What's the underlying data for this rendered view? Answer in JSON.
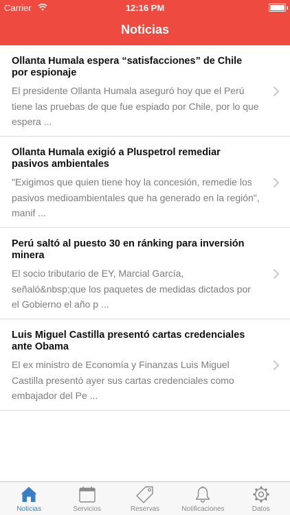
{
  "status_bar": {
    "carrier": "Carrier",
    "time": "12:16 PM"
  },
  "header": {
    "title": "Noticias"
  },
  "news": [
    {
      "title": "Ollanta Humala espera “satisfacciones” de Chile por espionaje",
      "summary": "El presidente Ollanta Humala aseguró hoy que el Perú tiene las pruebas de que fue espiado por Chile, por lo que espera ..."
    },
    {
      "title": "Ollanta Humala exigió a Pluspetrol remediar pasivos ambientales",
      "summary": "\"Exigimos que quien tiene hoy la concesión, remedie los pasivos medioambientales que ha generado en la región\", manif ..."
    },
    {
      "title": "Perú saltó al puesto 30 en ránking para inversión minera",
      "summary": "El socio tributario de EY, Marcial García, señaló&nbsp;que los paquetes de medidas dictados por el Gobierno el año p ..."
    },
    {
      "title": "Luis Miguel Castilla presentó cartas credenciales ante Obama",
      "summary": "El ex ministro de Economía y Finanzas Luis Miguel Castilla presentó ayer sus cartas credenciales como embajador del Pe ..."
    }
  ],
  "tabs": [
    {
      "label": "Noticias",
      "icon": "home-icon",
      "active": true
    },
    {
      "label": "Servicios",
      "icon": "calendar-icon",
      "active": false
    },
    {
      "label": "Reservas",
      "icon": "tag-icon",
      "active": false
    },
    {
      "label": "Notificaciones",
      "icon": "bell-icon",
      "active": false
    },
    {
      "label": "Datos",
      "icon": "gear-icon",
      "active": false
    }
  ],
  "colors": {
    "header": "#ef4a3f",
    "active_tab": "#3a7fc4",
    "inactive_tab": "#8a8a8a"
  }
}
